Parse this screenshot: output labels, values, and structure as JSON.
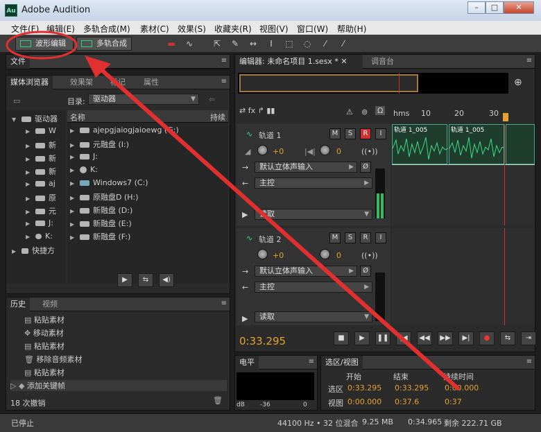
{
  "window": {
    "title": "Adobe Audition",
    "logo": "Au",
    "min": "–",
    "max": "□",
    "close": "✕"
  },
  "menu": [
    "文件(F)",
    "编辑(E)",
    "多轨合成(M)",
    "素材(C)",
    "效果(S)",
    "收藏夹(R)",
    "视图(V)",
    "窗口(W)",
    "帮助(H)"
  ],
  "toolbar": {
    "wave_edit": "波形编辑",
    "multitrack": "多轨合成"
  },
  "files_panel": {
    "tab": "文件"
  },
  "browser": {
    "tabs": [
      "媒体浏览器",
      "效果架",
      "标记",
      "属性"
    ],
    "dir_label": "目录:",
    "dir_value": "驱动器",
    "col_name": "名称",
    "col_dur": "持续",
    "tree": [
      "驱动器",
      "W",
      "新",
      "新",
      "新",
      "aj",
      "原",
      "元",
      "J:",
      "K:",
      "快捷方"
    ],
    "files": [
      "ajepgjaiogjaioewg (G:)",
      "元融盘 (I:)",
      "J:",
      "K:",
      "Windows7 (C:)",
      "原融盘D (H:)",
      "新融盘 (D:)",
      "新融盘 (E:)",
      "新融盘 (F:)"
    ]
  },
  "history": {
    "tabs": [
      "历史",
      "视频"
    ],
    "items": [
      "粘贴素材",
      "移动素材",
      "粘贴素材",
      "移除音频素材",
      "粘贴素材",
      "添加关键帧"
    ],
    "undo_count": "18 次撤销"
  },
  "editor": {
    "tab": "编辑器: 未命名项目 1.sesx *",
    "mixer_tab": "调音台",
    "ruler": [
      "hms",
      "10",
      "20",
      "30"
    ],
    "tracks": [
      {
        "name": "轨道 1",
        "vol": "+0",
        "pan": "0",
        "input": "默认立体声输入",
        "output": "主控",
        "mode": "读取",
        "clips": [
          "轨道 1_005",
          "轨道 1_005"
        ]
      },
      {
        "name": "轨道 2",
        "vol": "+0",
        "pan": "0",
        "input": "默认立体声输入",
        "output": "主控",
        "mode": "读取"
      }
    ],
    "time": "0:33.295"
  },
  "meter": {
    "tab": "电平",
    "scale": [
      "dB",
      "-36",
      "0"
    ]
  },
  "selection": {
    "tab": "选区/视图",
    "col_start": "开始",
    "col_end": "结束",
    "col_dur": "持续时间",
    "row_sel": "选区",
    "row_view": "视图",
    "sel_start": "0:33.295",
    "sel_end": "0:33.295",
    "sel_dur": "0:00.000",
    "view_start": "0:00.000",
    "view_end": "0:37.6",
    "view_dur": "0:37"
  },
  "status": {
    "left": "已停止",
    "sample": "44100 Hz • 32 位混合",
    "size": "9.25 MB",
    "dur": "0:34.965",
    "free": "剩余 222.71 GB"
  },
  "colors": {
    "annotation": "#e03030",
    "accent": "#e5a32c",
    "wave": "#3ddc84"
  }
}
